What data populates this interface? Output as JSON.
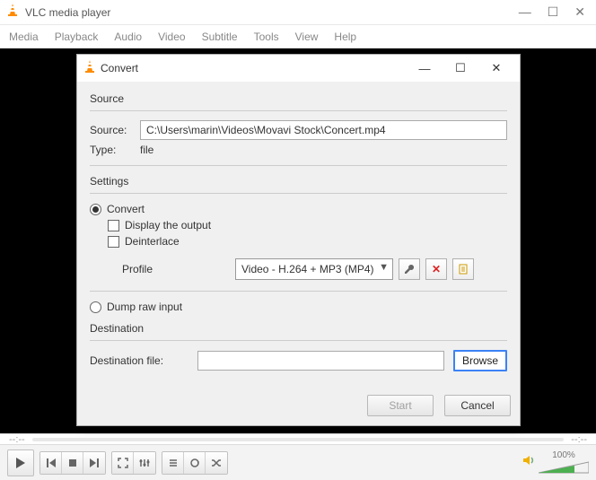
{
  "main": {
    "title": "VLC media player",
    "menus": [
      "Media",
      "Playback",
      "Audio",
      "Video",
      "Subtitle",
      "Tools",
      "View",
      "Help"
    ],
    "seek_left": "--:--",
    "seek_right": "--:--",
    "volume_label": "100%"
  },
  "dialog": {
    "title": "Convert",
    "source": {
      "section_label": "Source",
      "source_label": "Source:",
      "source_value": "C:\\Users\\marin\\Videos\\Movavi Stock\\Concert.mp4",
      "type_label": "Type:",
      "type_value": "file"
    },
    "settings": {
      "section_label": "Settings",
      "convert_label": "Convert",
      "display_output_label": "Display the output",
      "deinterlace_label": "Deinterlace",
      "profile_label": "Profile",
      "profile_value": "Video - H.264 + MP3 (MP4)",
      "dump_label": "Dump raw input"
    },
    "destination": {
      "section_label": "Destination",
      "file_label": "Destination file:",
      "file_value": "",
      "browse_label": "Browse"
    },
    "footer": {
      "start_label": "Start",
      "cancel_label": "Cancel"
    }
  }
}
